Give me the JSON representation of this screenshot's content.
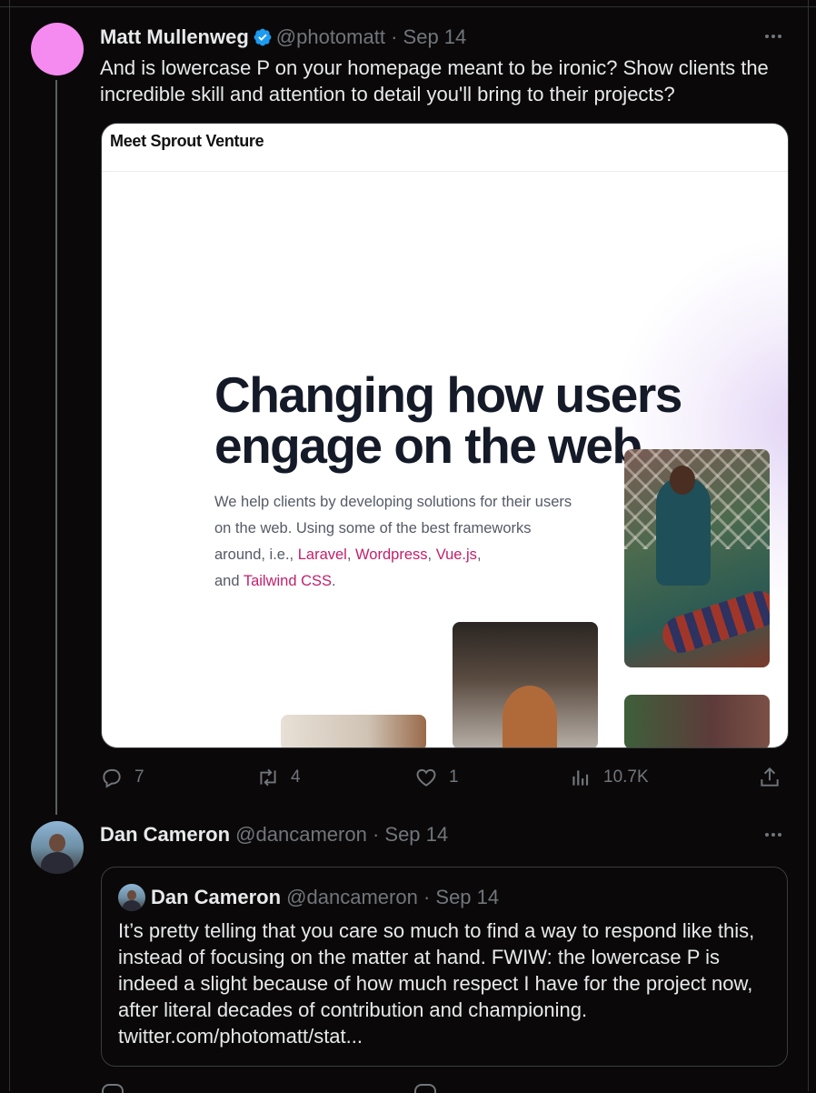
{
  "tweet1": {
    "name": "Matt Mullenweg",
    "handle": "@photomatt",
    "sep": "·",
    "date": "Sep 14",
    "text": "And is lowercase P on your homepage meant to be ironic? Show clients the incredible skill and attention to detail you'll bring to their projects?",
    "avatar_color": "#f58af0",
    "verified_icon": "verified-badge-icon",
    "card": {
      "brand": "Meet Sprout Venture",
      "headline_line1": "Changing how users",
      "headline_line2": "engage on the web",
      "sub_1": "We help clients by developing solutions for their users on the web. Using some of the best frameworks around, i.e., ",
      "link_laravel": "Laravel",
      "comma1": ", ",
      "link_wordpress": "Wordpress",
      "comma2": ", ",
      "link_vue": "Vue.js",
      "sub_2": ",",
      "sub_and": "and ",
      "link_tailwind": "Tailwind CSS",
      "period": "."
    },
    "actions": {
      "replies": "7",
      "retweets": "4",
      "likes": "1",
      "views": "10.7K"
    }
  },
  "tweet2": {
    "name": "Dan Cameron",
    "handle": "@dancameron",
    "sep": "·",
    "date": "Sep 14",
    "quote": {
      "name": "Dan Cameron",
      "handle": "@dancameron",
      "sep": "·",
      "date": "Sep 14",
      "text": "It’s pretty telling that you care so much to find a way to respond like this, instead of focusing on the matter at hand. FWIW: the lowercase P is indeed a slight because of how much respect I have for the project now, after literal decades of contribution and championing. twitter.com/photomatt/stat..."
    }
  },
  "colors": {
    "background": "#0a0809",
    "text": "#e7e9ea",
    "muted": "#71767b",
    "verified": "#1d9bf0",
    "link_pink": "#c2206b"
  }
}
